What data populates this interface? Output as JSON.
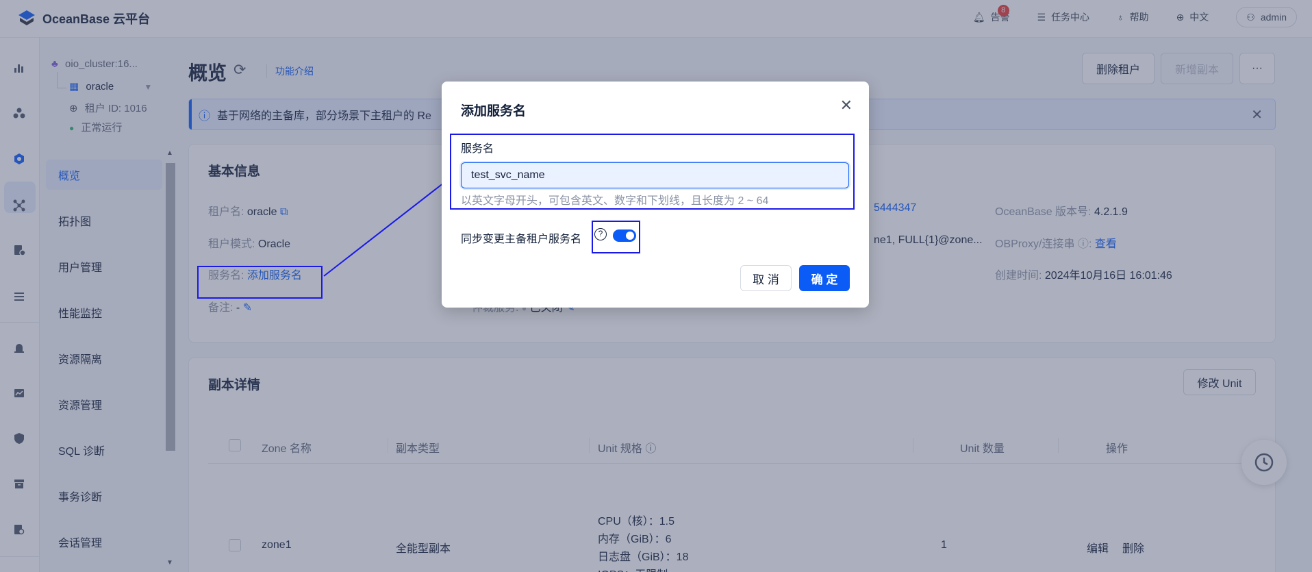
{
  "topbar": {
    "logo_text": "OceanBase 云平台",
    "alert_label": "告警",
    "alert_count": "8",
    "task_center": "任务中心",
    "help": "帮助",
    "language": "中文",
    "user": "admin"
  },
  "sidebar": {
    "cluster": "oio_cluster:16...",
    "tenant": "oracle",
    "tenant_id": "租户 ID: 1016",
    "status": "正常运行",
    "items": [
      {
        "label": "概览"
      },
      {
        "label": "拓扑图"
      },
      {
        "label": "用户管理"
      },
      {
        "label": "性能监控"
      },
      {
        "label": "资源隔离"
      },
      {
        "label": "资源管理"
      },
      {
        "label": "SQL 诊断"
      },
      {
        "label": "事务诊断"
      },
      {
        "label": "会话管理"
      }
    ]
  },
  "page": {
    "title": "概览",
    "feature_link": "功能介绍",
    "delete_tenant": "删除租户",
    "add_replica": "新增副本",
    "more": "···",
    "alert_text": "基于网络的主备库，部分场景下主租户的 Re"
  },
  "basic_info": {
    "title": "基本信息",
    "tenant_name_key": "租户名:",
    "tenant_name": "oracle",
    "tenant_mode_key": "租户模式:",
    "tenant_mode": "Oracle",
    "service_key": "服务名:",
    "service_link": "添加服务名",
    "remark_key": "备注:",
    "remark": "-",
    "arbitration_key": "仲裁服务:",
    "arbitration": "已关闭",
    "id_partial": "5444347",
    "locality_partial": "ne1, FULL{1}@zone...",
    "version_key": "OceanBase 版本号:",
    "version": "4.2.1.9",
    "obproxy_key": "OBProxy/连接串",
    "obproxy_link": "查看",
    "created_key": "创建时间:",
    "created": "2024年10月16日 16:01:46"
  },
  "replica": {
    "title": "副本详情",
    "modify_unit": "修改 Unit",
    "headers": [
      "Zone 名称",
      "副本类型",
      "Unit 规格",
      "Unit 数量",
      "操作"
    ],
    "row": {
      "zone": "zone1",
      "type": "全能型副本",
      "cpu": "CPU（核）：1.5",
      "mem": "内存（GiB）：6",
      "log": "日志盘（GiB）：18",
      "iops": "IOPS：无限制",
      "count": "1",
      "edit": "编辑",
      "delete": "删除"
    }
  },
  "modal": {
    "title": "添加服务名",
    "field_label": "服务名",
    "field_value": "test_svc_name",
    "hint": "以英文字母开头，可包含英文、数字和下划线，且长度为 2 ~ 64",
    "sync_label": "同步变更主备租户服务名",
    "sync_enabled": true,
    "cancel": "取 消",
    "ok": "确 定"
  },
  "colors": {
    "primary": "#0b5cf7",
    "annotation": "#1a1ae8"
  }
}
